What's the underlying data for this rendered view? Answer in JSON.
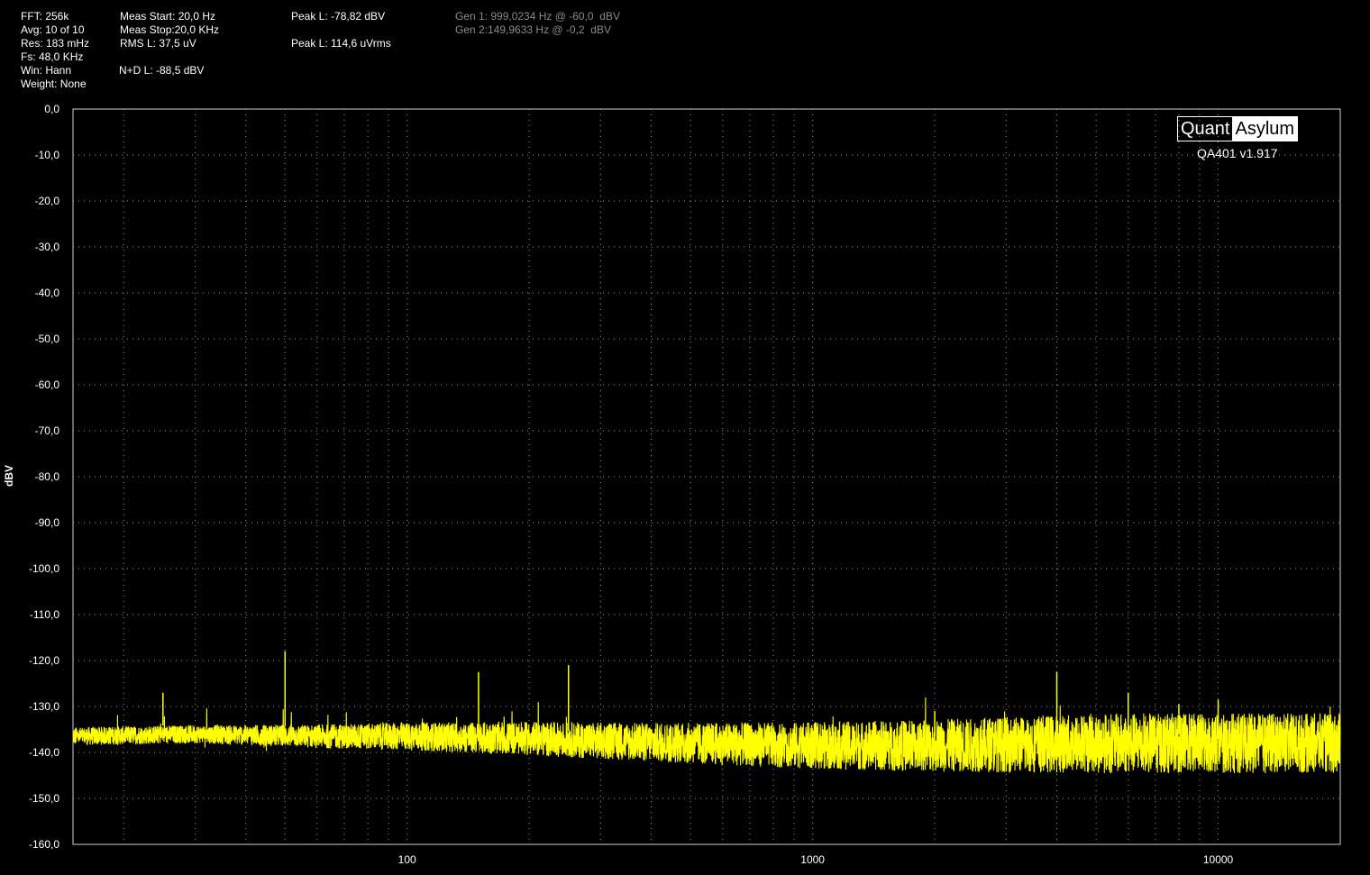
{
  "header": {
    "col1": [
      "FFT: 256k",
      "Avg: 10 of 10",
      "Res: 183 mHz",
      "Fs: 48,0 KHz",
      "Win: Hann",
      "Weight: None"
    ],
    "col2": [
      "Meas Start: 20,0 Hz",
      "Meas Stop:20,0 KHz",
      "RMS L: 37,5 uV",
      "",
      "N+D L: -88,5 dBV"
    ],
    "col3": [
      "Peak L: -78,82 dBV",
      "",
      "Peak L: 114,6 uVrms"
    ],
    "gen": [
      "Gen 1: 999,0234 Hz @ -60,0  dBV",
      "Gen 2:149,9633 Hz @ -0,2  dBV"
    ]
  },
  "logo": {
    "left": "Quant",
    "right": "Asylum",
    "version": "QA401 v1.917"
  },
  "colors": {
    "trace": "#ffff00",
    "grid": "#9a9a9a",
    "background": "#000000",
    "gen_text": "#8a8a8a"
  },
  "chart_data": {
    "type": "line",
    "title": "",
    "xlabel": "",
    "ylabel": "dBV",
    "xscale": "log",
    "xlim": [
      15,
      20000
    ],
    "ylim": [
      -160,
      0
    ],
    "yticks": [
      0,
      -10,
      -20,
      -30,
      -40,
      -50,
      -60,
      -70,
      -80,
      -90,
      -100,
      -110,
      -120,
      -130,
      -140,
      -150,
      -160
    ],
    "ytick_labels": [
      "0,0",
      "-10,0",
      "-20,0",
      "-30,0",
      "-40,0",
      "-50,0",
      "-60,0",
      "-70,0",
      "-80,0",
      "-90,0",
      "-100,0",
      "-110,0",
      "-120,0",
      "-130,0",
      "-140,0",
      "-150,0",
      "-160,0"
    ],
    "xticks": [
      100,
      1000,
      10000
    ],
    "xtick_labels": [
      "100",
      "1000",
      "10000"
    ],
    "grid": true,
    "series": [
      {
        "name": "",
        "noise_floor": [
          [
            15,
            -136.5
          ],
          [
            30,
            -136
          ],
          [
            60,
            -136.5
          ],
          [
            100,
            -136.5
          ],
          [
            200,
            -137
          ],
          [
            500,
            -138
          ],
          [
            1000,
            -138.5
          ],
          [
            2000,
            -138.5
          ],
          [
            5000,
            -138
          ],
          [
            10000,
            -138
          ],
          [
            20000,
            -138
          ]
        ],
        "spikes": [
          {
            "x": 25,
            "y": -127
          },
          {
            "x": 50,
            "y": -118
          },
          {
            "x": 150,
            "y": -122.5
          },
          {
            "x": 250,
            "y": -121
          },
          {
            "x": 4000,
            "y": -122.5
          },
          {
            "x": 6000,
            "y": -127
          },
          {
            "x": 8000,
            "y": -129.5
          },
          {
            "x": 10000,
            "y": -128.5
          },
          {
            "x": 2000,
            "y": -131
          }
        ]
      }
    ]
  }
}
